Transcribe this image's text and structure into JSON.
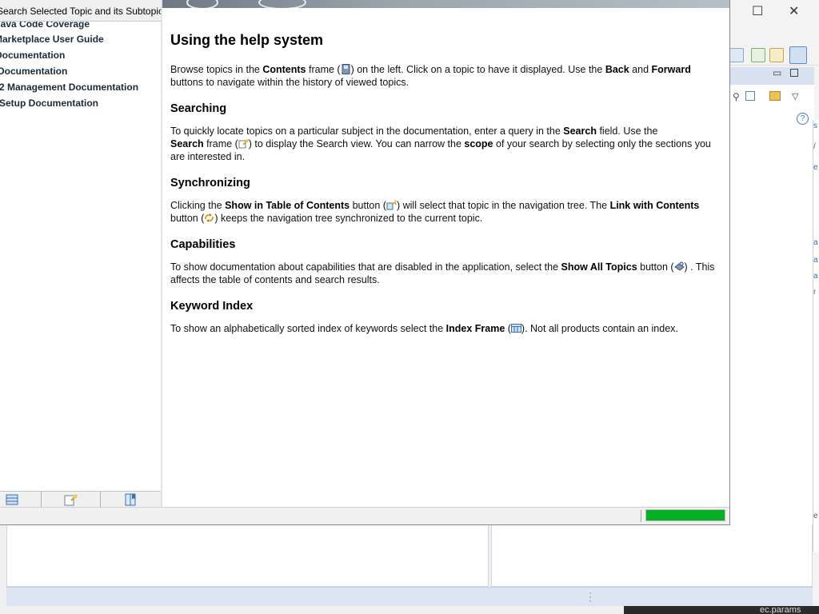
{
  "toc": {
    "header": "Search Selected Topic and its Subtopics",
    "items": [
      "Java Code Coverage",
      "Marketplace User Guide",
      "Documentation",
      "Documentation",
      "2 Management Documentation",
      "Setup Documentation"
    ],
    "tabs": [
      "contents-tab-icon",
      "search-tab-icon",
      "bookmarks-tab-icon"
    ]
  },
  "article": {
    "title": "Using the help system",
    "intro": {
      "t1": "Browse topics in the ",
      "b1": "Contents",
      "t2": " frame (",
      "t3": ") on the left. Click on a topic to have it displayed. Use the ",
      "b2": "Back",
      "t4": " and ",
      "b3": "Forward",
      "t5": " buttons to navigate within the history of viewed topics."
    },
    "searching": {
      "heading": "Searching",
      "t1": "To quickly locate topics on a particular subject in the documentation, enter a query in the ",
      "b1": "Search",
      "t2": " field. Use the ",
      "b2": "Search",
      "t3": " frame (",
      "t4": ") to display the Search view. You can narrow the ",
      "b3": "scope",
      "t5": " of your search by selecting only the sections you are interested in."
    },
    "synchronizing": {
      "heading": "Synchronizing",
      "t1": "Clicking the ",
      "b1": "Show in Table of Contents",
      "t2": " button (",
      "t3": ") will select that topic in the navigation tree. The ",
      "b2": "Link with Contents",
      "t4": " button (",
      "t5": ") keeps the navigation tree synchronized to the current topic."
    },
    "capabilities": {
      "heading": "Capabilities",
      "t1": "To show documentation about capabilities that are disabled in the application, select the ",
      "b1": "Show All Topics",
      "t2": " button (",
      "t3": ") . This affects the table of contents and search results."
    },
    "keyword_index": {
      "heading": "Keyword Index",
      "t1": "To show an alphabetically sorted index of keywords select the ",
      "b1": "Index Frame",
      "t2": " (",
      "t3": "). Not all products contain an index."
    }
  },
  "status": {
    "progress_fraction": 1.0,
    "progress_color": "#06b025"
  },
  "ide": {
    "bottom_label": "ec.params",
    "minimize_glyph": "☐",
    "close_glyph": "✕"
  }
}
